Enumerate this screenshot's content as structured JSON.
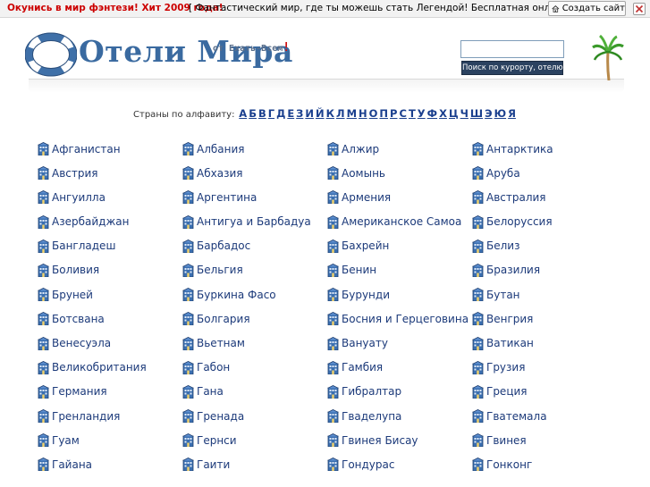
{
  "topbar": {
    "promo_link": "Окунись в мир фэнтези! Хит 2009 года!",
    "promo_text": "[ Фантастический мир, где ты можешь стать Легендой! Бесплатная онлайн-игра! ]",
    "create_site_label": "Создать сайт"
  },
  "header": {
    "logo_title": "Отели Мира",
    "logo_sub": "от Ехать-Всем",
    "logo_sub_mark": "!",
    "search_placeholder": "",
    "search_button": "Поиск по курорту, отелю!"
  },
  "alphabet": {
    "label": "Страны по алфавиту:",
    "letters": [
      "А",
      "Б",
      "В",
      "Г",
      "Д",
      "Е",
      "З",
      "И",
      "Й",
      "К",
      "Л",
      "М",
      "Н",
      "О",
      "П",
      "Р",
      "С",
      "Т",
      "У",
      "Ф",
      "Х",
      "Ц",
      "Ч",
      "Ш",
      "Э",
      "Ю",
      "Я"
    ]
  },
  "countries": [
    "Афганистан",
    "Албания",
    "Алжир",
    "Антарктика",
    "Австрия",
    "Абхазия",
    "Аомынь",
    "Аруба",
    "Ангуилла",
    "Аргентина",
    "Армения",
    "Австралия",
    "Азербайджан",
    "Антигуа и Барбадуа",
    "Американское Самоа",
    "Белоруссия",
    "Бангладеш",
    "Барбадос",
    "Бахрейн",
    "Белиз",
    "Боливия",
    "Бельгия",
    "Бенин",
    "Бразилия",
    "Бруней",
    "Буркина Фасо",
    "Бурунди",
    "Бутан",
    "Ботсвана",
    "Болгария",
    "Босния и Герцеговина",
    "Венгрия",
    "Венесуэла",
    "Вьетнам",
    "Вануату",
    "Ватикан",
    "Великобритания",
    "Габон",
    "Гамбия",
    "Грузия",
    "Германия",
    "Гана",
    "Гибралтар",
    "Греция",
    "Гренландия",
    "Гренада",
    "Гваделупа",
    "Гватемала",
    "Гуам",
    "Гернси",
    "Гвинея Бисау",
    "Гвинея",
    "Гайана",
    "Гаити",
    "Гондурас",
    "Гонконг"
  ],
  "colors": {
    "link": "#1c3a7a",
    "promo": "#cc0000",
    "search_button_bg": "#2b4260",
    "logo": "#3a6aa0"
  },
  "icons": {
    "country": "hotel-building-icon",
    "create_site": "home-icon",
    "close": "close-icon",
    "logo": "lifebuoy-icon",
    "decoration": "palm-tree-icon"
  }
}
